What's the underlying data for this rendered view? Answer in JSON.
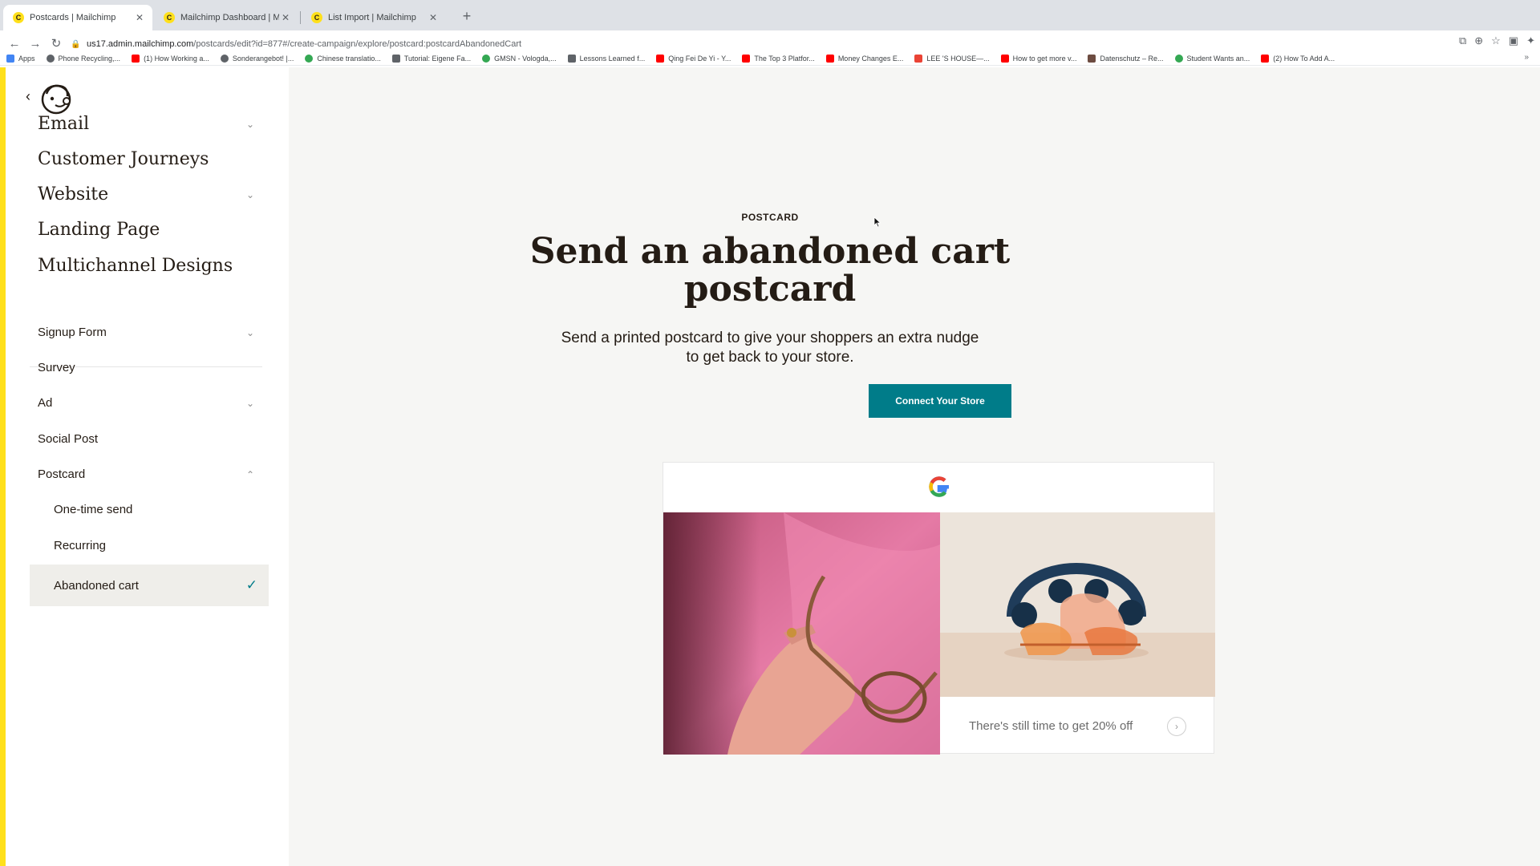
{
  "browser": {
    "tabs": [
      {
        "label": "Postcards | Mailchimp",
        "favicon": "mailchimp-icon",
        "active": true
      },
      {
        "label": "Mailchimp Dashboard | Mailch",
        "favicon": "mailchimp-icon",
        "active": false
      },
      {
        "label": "List Import | Mailchimp",
        "favicon": "mailchimp-icon",
        "active": false
      }
    ],
    "url_host": "us17.admin.mailchimp.com",
    "url_path": "/postcards/edit?id=877#/create-campaign/explore/postcard:postcardAbandonedCart",
    "bookmarks": [
      {
        "label": "Apps",
        "color": "#4285f4"
      },
      {
        "label": "Phone Recycling,...",
        "color": "#5f6368"
      },
      {
        "label": "(1) How Working a...",
        "color": "#ff0000"
      },
      {
        "label": "Sonderangebot! |...",
        "color": "#5f6368"
      },
      {
        "label": "Chinese translatio...",
        "color": "#34a853"
      },
      {
        "label": "Tutorial: Eigene Fa...",
        "color": "#5f6368"
      },
      {
        "label": "GMSN - Vologda,...",
        "color": "#34a853"
      },
      {
        "label": "Lessons Learned f...",
        "color": "#5f6368"
      },
      {
        "label": "Qing Fei De Yi - Y...",
        "color": "#ff0000"
      },
      {
        "label": "The Top 3 Platfor...",
        "color": "#ff0000"
      },
      {
        "label": "Money Changes E...",
        "color": "#ff0000"
      },
      {
        "label": "LEE 'S HOUSE—...",
        "color": "#ea4335"
      },
      {
        "label": "How to get more v...",
        "color": "#ff0000"
      },
      {
        "label": "Datenschutz – Re...",
        "color": "#6d4c41"
      },
      {
        "label": "Student Wants an...",
        "color": "#34a853"
      },
      {
        "label": "(2) How To Add A...",
        "color": "#ff0000"
      }
    ],
    "bookmarks_more": "»"
  },
  "sidebar": {
    "primary": [
      {
        "label": "Email",
        "expandable": true
      },
      {
        "label": "Customer Journeys",
        "expandable": false
      },
      {
        "label": "Website",
        "expandable": true
      },
      {
        "label": "Landing Page",
        "expandable": false
      },
      {
        "label": "Multichannel Designs",
        "expandable": false
      }
    ],
    "secondary": [
      {
        "label": "Signup Form",
        "expandable": true
      },
      {
        "label": "Survey",
        "expandable": false
      },
      {
        "label": "Ad",
        "expandable": true
      },
      {
        "label": "Social Post",
        "expandable": false
      },
      {
        "label": "Postcard",
        "expandable": true,
        "expanded": true
      }
    ],
    "postcard_sub": [
      {
        "label": "One-time send"
      },
      {
        "label": "Recurring"
      },
      {
        "label": "Abandoned cart",
        "selected": true
      }
    ]
  },
  "main": {
    "eyebrow": "POSTCARD",
    "headline_line1": "Send an abandoned cart",
    "headline_line2": "postcard",
    "sub_line1": "Send a printed postcard to give your shoppers an extra nudge",
    "sub_line2": "to get back to your store.",
    "cta_label": "Connect Your Store",
    "card": {
      "promo_text": "There's still time to get 20% off"
    }
  },
  "colors": {
    "brand_yellow": "#ffe01b",
    "cta_teal": "#007c89",
    "sidebar_bg": "#ffffff",
    "main_bg": "#f6f6f4"
  }
}
